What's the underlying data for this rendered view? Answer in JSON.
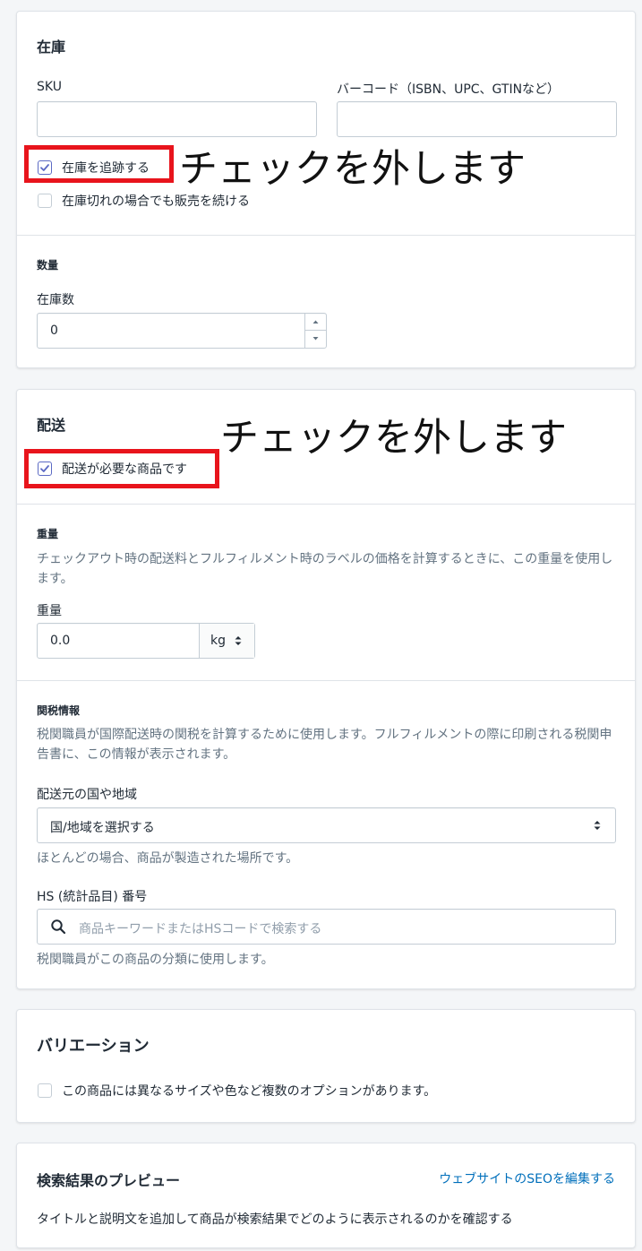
{
  "inventory": {
    "title": "在庫",
    "sku_label": "SKU",
    "sku_value": "",
    "barcode_label": "バーコード（ISBN、UPC、GTINなど）",
    "barcode_value": "",
    "track_label": "在庫を追跡する",
    "track_checked": true,
    "continue_label": "在庫切れの場合でも販売を続ける",
    "continue_checked": false,
    "quantity_heading": "数量",
    "available_label": "在庫数",
    "available_value": "0"
  },
  "shipping": {
    "title": "配送",
    "physical_label": "配送が必要な商品です",
    "physical_checked": true,
    "weight_heading": "重量",
    "weight_help": "チェックアウト時の配送料とフルフィルメント時のラベルの価格を計算するときに、この重量を使用します。",
    "weight_label": "重量",
    "weight_value": "0.0",
    "weight_unit": "kg",
    "customs_heading": "関税情報",
    "customs_help": "税関職員が国際配送時の関税を計算するために使用します。フルフィルメントの際に印刷される税関申告書に、この情報が表示されます。",
    "origin_label": "配送元の国や地域",
    "origin_value": "国/地域を選択する",
    "origin_help": "ほとんどの場合、商品が製造された場所です。",
    "hs_label": "HS (統計品目) 番号",
    "hs_placeholder": "商品キーワードまたはHSコードで検索する",
    "hs_help": "税関職員がこの商品の分類に使用します。"
  },
  "variants": {
    "title": "バリエーション",
    "options_label": "この商品には異なるサイズや色など複数のオプションがあります。",
    "options_checked": false
  },
  "seo": {
    "title": "検索結果のプレビュー",
    "edit_link": "ウェブサイトのSEOを編集する",
    "help": "タイトルと説明文を追加して商品が検索結果でどのように表示されるのかを確認する"
  },
  "annotations": {
    "first": "チェックを外します",
    "second": "チェックを外します"
  },
  "colors": {
    "accent": "#5c6ac4",
    "highlight": "#e8141c",
    "link": "#006fbb"
  },
  "icons": [
    "checkmark-icon",
    "spinner-up-icon",
    "spinner-down-icon",
    "select-arrows-icon",
    "search-icon"
  ]
}
